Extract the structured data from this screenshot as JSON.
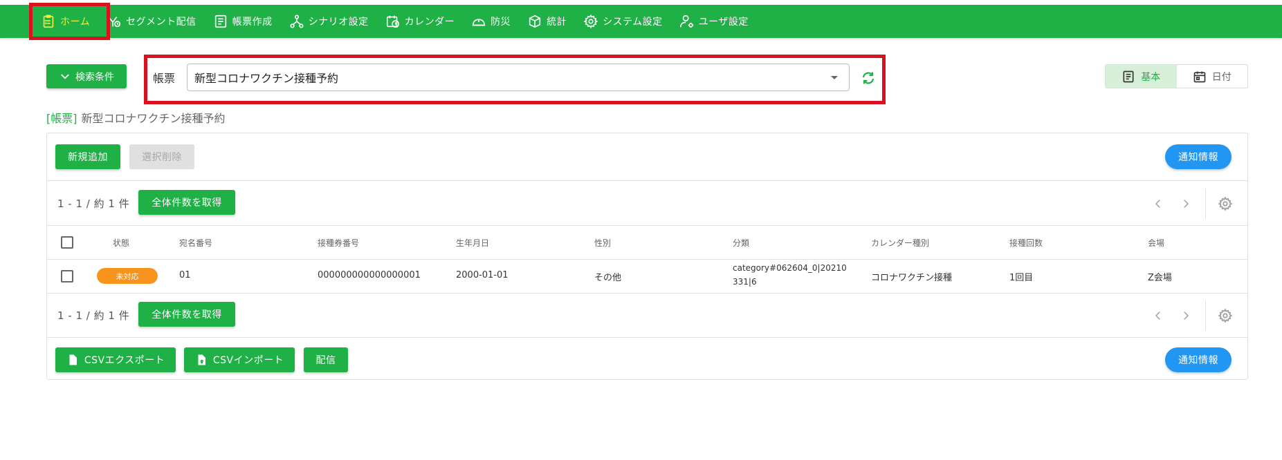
{
  "nav": {
    "items": [
      {
        "label": "ホーム",
        "icon": "home-clipboard-icon"
      },
      {
        "label": "セグメント配信",
        "icon": "segment-icon"
      },
      {
        "label": "帳票作成",
        "icon": "form-icon"
      },
      {
        "label": "シナリオ設定",
        "icon": "scenario-icon"
      },
      {
        "label": "カレンダー",
        "icon": "calendar-clock-icon"
      },
      {
        "label": "防災",
        "icon": "disaster-icon"
      },
      {
        "label": "統計",
        "icon": "stats-cube-icon"
      },
      {
        "label": "システム設定",
        "icon": "gear-icon"
      },
      {
        "label": "ユーザ設定",
        "icon": "user-settings-icon"
      }
    ]
  },
  "toolbar": {
    "search_conditions": "検索条件",
    "form_label": "帳票",
    "form_select_value": "新型コロナワクチン接種予約",
    "view_basic": "基本",
    "view_date": "日付"
  },
  "breadcrumb": {
    "tag": "[帳票]",
    "title": "新型コロナワクチン接種予約"
  },
  "card": {
    "add_new": "新規追加",
    "delete_selected": "選択削除",
    "notify_info": "通知情報",
    "count_text": "1 - 1 / 約 1 件",
    "get_total": "全体件数を取得",
    "csv_export": "CSVエクスポート",
    "csv_import": "CSVインポート",
    "deliver": "配信"
  },
  "table": {
    "headers": [
      "状態",
      "宛名番号",
      "接種券番号",
      "生年月日",
      "性別",
      "分類",
      "カレンダー種別",
      "接種回数",
      "会場"
    ],
    "rows": [
      {
        "status": "未対応",
        "address_no": "01",
        "ticket_no": "000000000000000001",
        "birth_date": "2000-01-01",
        "gender": "その他",
        "category_line1": "category#062604_0|20210",
        "category_line2": "331|6",
        "calendar_type": "コロナワクチン接種",
        "dose_count": "1回目",
        "venue": "Z会場"
      }
    ]
  },
  "colors": {
    "primary_green": "#1fb046",
    "highlight_red": "#d8131f",
    "active_nav_text": "#f6ee3a",
    "status_orange": "#f7941d",
    "notify_blue": "#2196f3"
  }
}
